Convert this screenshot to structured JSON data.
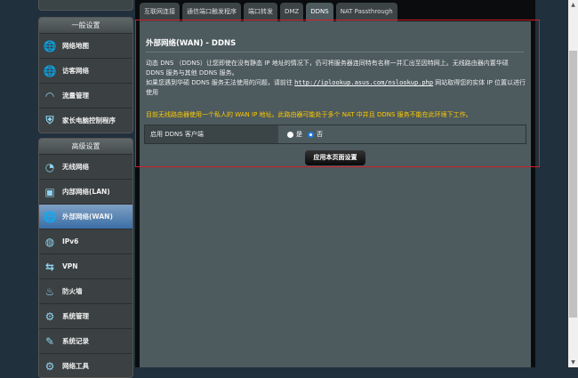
{
  "sidebar": {
    "general_header": "一般设置",
    "general_items": [
      {
        "label": "网络地图",
        "icon": "globe-map-icon"
      },
      {
        "label": "访客网络",
        "icon": "guest-network-icon"
      },
      {
        "label": "流量管理",
        "icon": "speedometer-icon"
      },
      {
        "label": "家长电脑控制程序",
        "icon": "shield-lock-icon"
      }
    ],
    "advanced_header": "高级设置",
    "advanced_items": [
      {
        "label": "无线网络",
        "icon": "wifi-icon"
      },
      {
        "label": "内部网络(LAN)",
        "icon": "lan-icon"
      },
      {
        "label": "外部网络(WAN)",
        "icon": "globe-icon",
        "selected": true
      },
      {
        "label": "IPv6",
        "icon": "ipv6-icon"
      },
      {
        "label": "VPN",
        "icon": "vpn-icon"
      },
      {
        "label": "防火墙",
        "icon": "firewall-icon"
      },
      {
        "label": "系统管理",
        "icon": "gear-icon"
      },
      {
        "label": "系统记录",
        "icon": "log-icon"
      },
      {
        "label": "网络工具",
        "icon": "tools-icon"
      }
    ]
  },
  "tabs": [
    "互联网连接",
    "通信端口触发程序",
    "端口转发",
    "DMZ",
    "DDNS",
    "NAT Passthrough"
  ],
  "active_tab": "DDNS",
  "main": {
    "title": "外部网络(WAN) - DDNS",
    "desc1": "动态 DNS （DDNS）让您即使在没有静态 IP 地址的情况下，仍可将服务器连同特有名称一并汇出至因特网上。无线路由器内置华硕 DDNS 服务与其他 DDNS 服务。",
    "desc2_pre": "如果您遇到华硕 DDNS 服务无法使用的问题，请前往 ",
    "desc2_link": "http://iplookup.asus.com/nslookup.php",
    "desc2_post": " 网站取得您的实体 IP 位置以进行使用",
    "warning": "目前无线路由器使用一个私人的 WAN IP 地址。此路由器可能处于多个 NAT 中并且 DDNS 服务不能在此环境下工作。",
    "field_label": "启用 DDNS 客户端",
    "option_yes": "是",
    "option_no": "否",
    "selected_option": "否",
    "apply_button": "应用本页面设置"
  },
  "colors": {
    "highlight_border": "#d0202a",
    "warning": "#ffcc00",
    "selected_item": "#3a6ea6"
  }
}
